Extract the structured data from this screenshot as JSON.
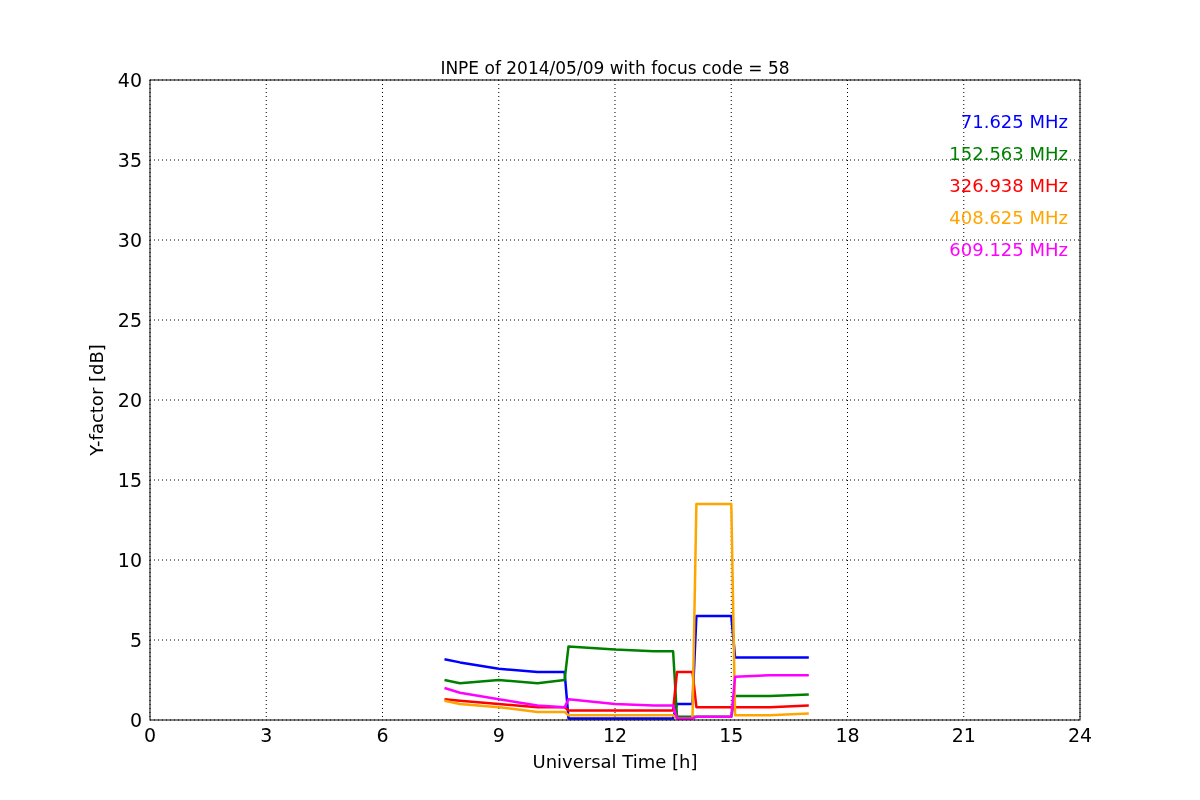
{
  "chart_data": {
    "type": "line",
    "title": "INPE of 2014/05/09 with focus code = 58",
    "xlabel": "Universal Time [h]",
    "ylabel": "Y-factor [dB]",
    "x": [
      7.6,
      8,
      9,
      10,
      10.7,
      10.8,
      12,
      13,
      13.5,
      13.6,
      14,
      14.1,
      15,
      15.1,
      16,
      17
    ],
    "series": [
      {
        "name": "71.625 MHz",
        "color": "#0000ff",
        "values": [
          3.8,
          3.6,
          3.2,
          3.0,
          3.0,
          0.1,
          0.1,
          0.1,
          0.1,
          1.0,
          1.0,
          6.5,
          6.5,
          3.9,
          3.9,
          3.9
        ]
      },
      {
        "name": "152.563 MHz",
        "color": "#008000",
        "values": [
          2.5,
          2.3,
          2.5,
          2.3,
          2.5,
          4.6,
          4.4,
          4.3,
          4.3,
          0.2,
          0.2,
          0.2,
          0.2,
          1.5,
          1.5,
          1.6
        ]
      },
      {
        "name": "326.938 MHz",
        "color": "#ff0000",
        "values": [
          1.3,
          1.2,
          1.0,
          0.8,
          0.8,
          0.6,
          0.6,
          0.6,
          0.6,
          3.0,
          3.0,
          0.8,
          0.8,
          0.8,
          0.8,
          0.9
        ]
      },
      {
        "name": "408.625 MHz",
        "color": "#ffa500",
        "values": [
          1.2,
          1.0,
          0.8,
          0.5,
          0.5,
          0.3,
          0.3,
          0.3,
          0.3,
          0.1,
          0.1,
          13.5,
          13.5,
          0.3,
          0.3,
          0.4
        ]
      },
      {
        "name": "609.125 MHz",
        "color": "#ff00ff",
        "values": [
          2.0,
          1.7,
          1.3,
          0.9,
          0.8,
          1.3,
          1.0,
          0.9,
          0.9,
          0.1,
          0.1,
          0.2,
          0.2,
          2.7,
          2.8,
          2.8
        ]
      }
    ],
    "grid": true,
    "xlim": [
      0,
      24
    ],
    "ylim": [
      0,
      40
    ],
    "xticks": [
      0,
      3,
      6,
      9,
      12,
      15,
      18,
      21,
      24
    ],
    "yticks": [
      0,
      5,
      10,
      15,
      20,
      25,
      30,
      35,
      40
    ]
  }
}
